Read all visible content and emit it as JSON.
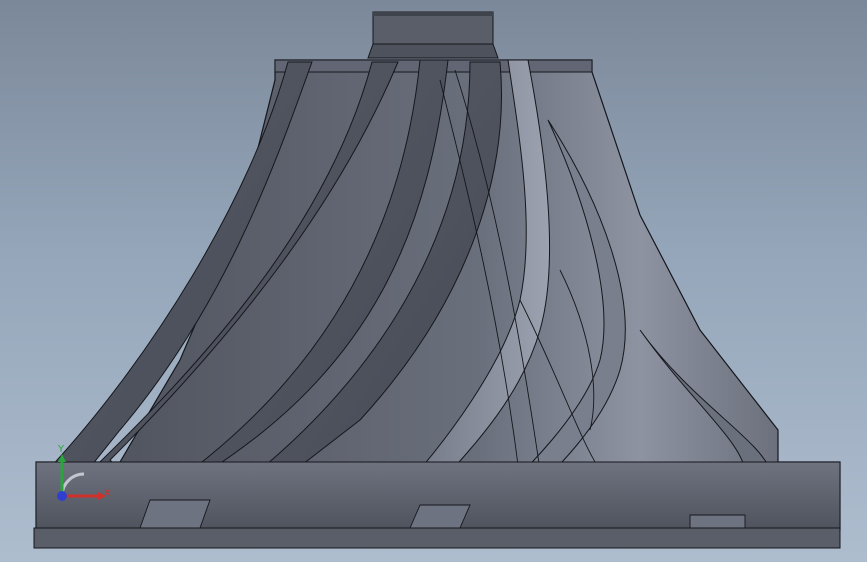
{
  "viewport": {
    "background_top": "#7b8899",
    "background_bottom": "#aebdce",
    "model_color": "#5b606d",
    "edge_color": "#15171c"
  },
  "triad": {
    "x_label": "X",
    "y_label": "Y",
    "x_color": "#d0302a",
    "y_color": "#2aa43c",
    "z_color": "#2f3fd0"
  }
}
